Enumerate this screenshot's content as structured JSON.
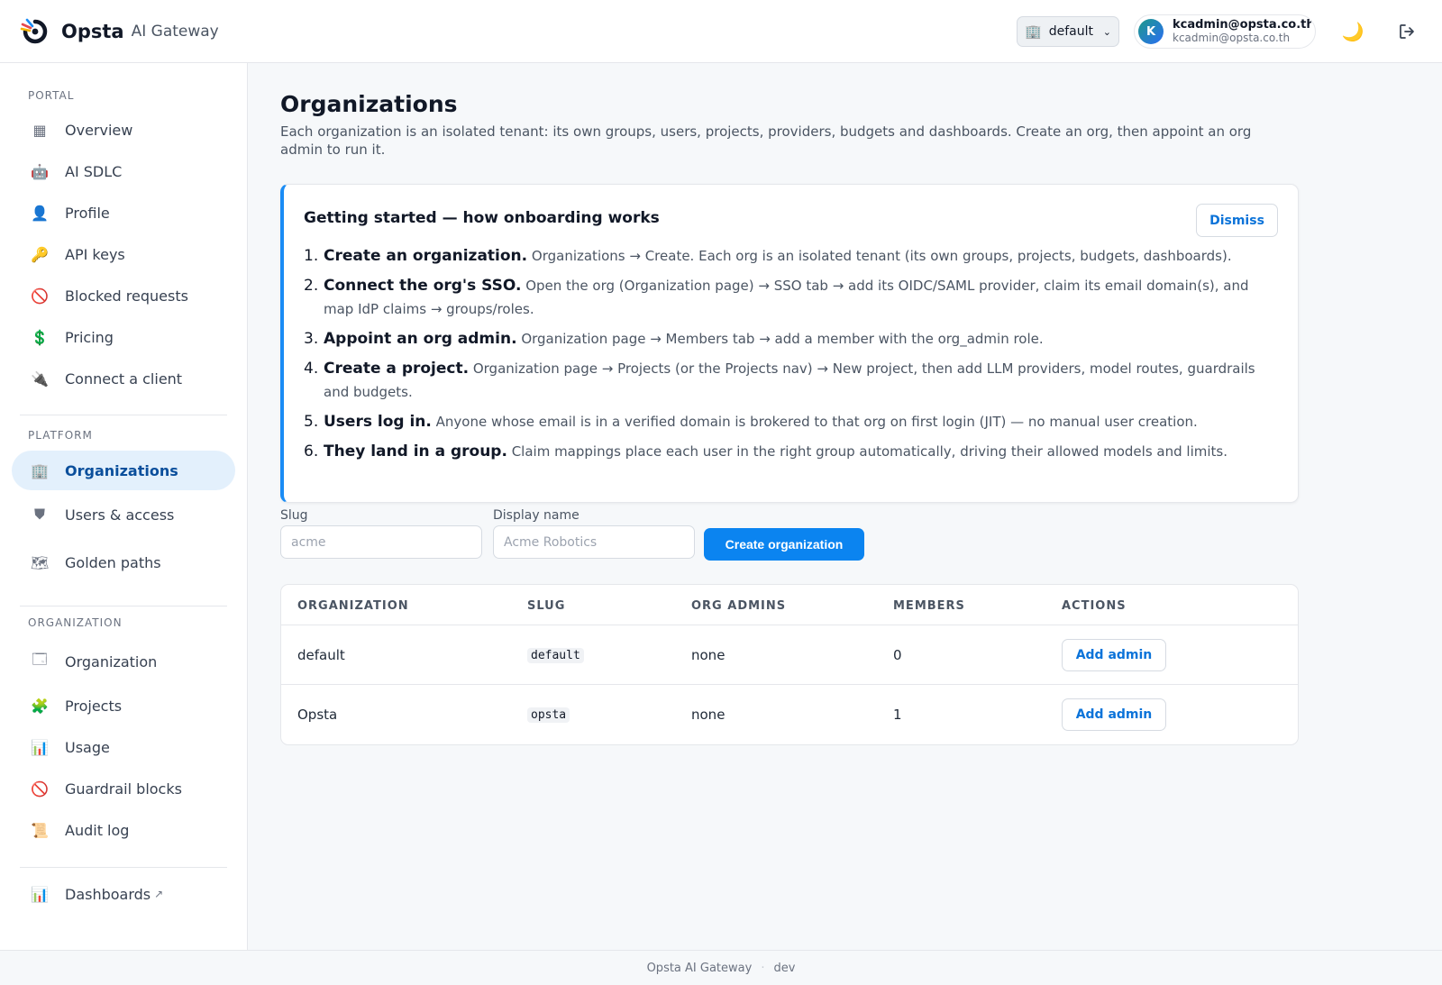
{
  "header": {
    "brand_name": "Opsta",
    "brand_sub": "AI Gateway",
    "org_selector": {
      "icon": "building-icon",
      "value": "default"
    },
    "user": {
      "initial": "K",
      "name": "kcadmin@opsta.co.th",
      "email": "kcadmin@opsta.co.th"
    },
    "theme_icon": "moon-icon",
    "logout_icon": "logout-icon"
  },
  "sidebar": {
    "portal_label": "PORTAL",
    "portal_items": [
      {
        "icon": "grid-icon",
        "glyph": "▦",
        "label": "Overview"
      },
      {
        "icon": "robot-icon",
        "glyph": "🤖",
        "label": "AI SDLC"
      },
      {
        "icon": "user-icon",
        "glyph": "👤",
        "label": "Profile"
      },
      {
        "icon": "key-icon",
        "glyph": "🔑",
        "label": "API keys"
      },
      {
        "icon": "blocked-icon",
        "glyph": "🚫",
        "label": "Blocked requests"
      },
      {
        "icon": "dollar-icon",
        "glyph": "💲",
        "label": "Pricing"
      },
      {
        "icon": "plug-icon",
        "glyph": "🔌",
        "label": "Connect a client"
      }
    ],
    "platform_label": "PLATFORM",
    "platform_items": [
      {
        "icon": "building-icon",
        "glyph": "🏢",
        "label": "Organizations"
      },
      {
        "icon": "shield-icon",
        "glyph": "⛊",
        "label": "Users & access"
      },
      {
        "icon": "map-icon",
        "glyph": "🗺",
        "label": "Golden paths"
      }
    ],
    "organization_label": "ORGANIZATION",
    "organization_items": [
      {
        "icon": "window-icon",
        "glyph": "🗔",
        "label": "Organization"
      },
      {
        "icon": "puzzle-icon",
        "glyph": "🧩",
        "label": "Projects"
      },
      {
        "icon": "bar-chart-icon",
        "glyph": "📊",
        "label": "Usage"
      },
      {
        "icon": "blocked-icon",
        "glyph": "🚫",
        "label": "Guardrail blocks"
      },
      {
        "icon": "scroll-icon",
        "glyph": "📜",
        "label": "Audit log"
      }
    ],
    "dashboards": {
      "icon": "bar-chart-icon",
      "glyph": "📊",
      "label": "Dashboards",
      "ext": "↗"
    }
  },
  "main": {
    "title": "Organizations",
    "description": "Each organization is an isolated tenant: its own groups, users, projects, providers, budgets and dashboards. Create an org, then appoint an org admin to run it.",
    "onboarding": {
      "title": "Getting started — how onboarding works",
      "dismiss_label": "Dismiss",
      "steps": [
        {
          "num": "1.",
          "title": "Create an organization.",
          "text": " Organizations → Create. Each org is an isolated tenant (its own groups, projects, budgets, dashboards)."
        },
        {
          "num": "2.",
          "title": "Connect the org's SSO.",
          "text": " Open the org (Organization page) → SSO tab → add its OIDC/SAML provider, claim its email domain(s), and map IdP claims → groups/roles."
        },
        {
          "num": "3.",
          "title": "Appoint an org admin.",
          "text": " Organization page → Members tab → add a member with the org_admin role."
        },
        {
          "num": "4.",
          "title": "Create a project.",
          "text": " Organization page → Projects (or the Projects nav) → New project, then add LLM providers, model routes, guardrails and budgets."
        },
        {
          "num": "5.",
          "title": "Users log in.",
          "text": " Anyone whose email is in a verified domain is brokered to that org on first login (JIT) — no manual user creation."
        },
        {
          "num": "6.",
          "title": "They land in a group.",
          "text": " Claim mappings place each user in the right group automatically, driving their allowed models and limits."
        }
      ]
    },
    "form": {
      "slug_label": "Slug",
      "slug_placeholder": "acme",
      "display_label": "Display name",
      "display_placeholder": "Acme Robotics",
      "create_label": "Create organization"
    },
    "table": {
      "headers": [
        "ORGANIZATION",
        "SLUG",
        "ORG ADMINS",
        "MEMBERS",
        "ACTIONS"
      ],
      "rows": [
        {
          "organization": "default",
          "slug": "default",
          "admins": "none",
          "members": "0",
          "action": "Add admin"
        },
        {
          "organization": "Opsta",
          "slug": "opsta",
          "admins": "none",
          "members": "1",
          "action": "Add admin"
        }
      ]
    }
  },
  "footer": {
    "app": "Opsta AI Gateway",
    "sep": "·",
    "env": "dev"
  },
  "colors": {
    "accent": "#0b84f0",
    "active_bg": "#e3f0fc",
    "active_text": "#0b4f9c",
    "moon": "#f5b400"
  }
}
